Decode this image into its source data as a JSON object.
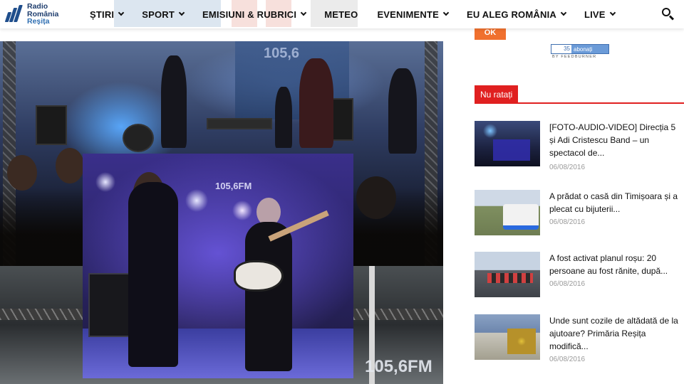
{
  "brand": {
    "line1": "Radio",
    "line2": "România",
    "line3": "Reșița"
  },
  "nav": {
    "items": [
      {
        "label": "ȘTIRI",
        "has_dropdown": true
      },
      {
        "label": "SPORT",
        "has_dropdown": true
      },
      {
        "label": "EMISIUNI & RUBRICI",
        "has_dropdown": true
      },
      {
        "label": "METEO",
        "has_dropdown": false
      },
      {
        "label": "EVENIMENTE",
        "has_dropdown": true
      },
      {
        "label": "EU ALEG ROMÂNIA",
        "has_dropdown": true
      },
      {
        "label": "LIVE",
        "has_dropdown": true
      }
    ],
    "search_icon": "search-icon"
  },
  "photos": {
    "stage_sign": "105,6",
    "overlay_sign": "105,6FM",
    "lower_sign": "105,6FM"
  },
  "sidebar": {
    "ok_label": "OK",
    "feed": {
      "count": "35",
      "label": "abonați",
      "by": "BY FEEDBURNER"
    },
    "section_title": "Nu ratați",
    "news": [
      {
        "title": "[FOTO-AUDIO-VIDEO] Direcția 5 și Adi Cristescu Band – un spectacol de...",
        "date": "06/08/2016"
      },
      {
        "title": "A prădat o casă din Timișoara și a plecat cu bijuterii...",
        "date": "06/08/2016"
      },
      {
        "title": "A fost activat planul roșu: 20 persoane au fost rănite, după...",
        "date": "06/08/2016"
      },
      {
        "title": "Unde sunt cozile de altădată de la ajutoare? Primăria Reșița modifică...",
        "date": "06/08/2016"
      }
    ]
  },
  "colors": {
    "accent_red": "#e02020",
    "ok_orange": "#f0702e",
    "brand_blue": "#1f4e8c"
  }
}
